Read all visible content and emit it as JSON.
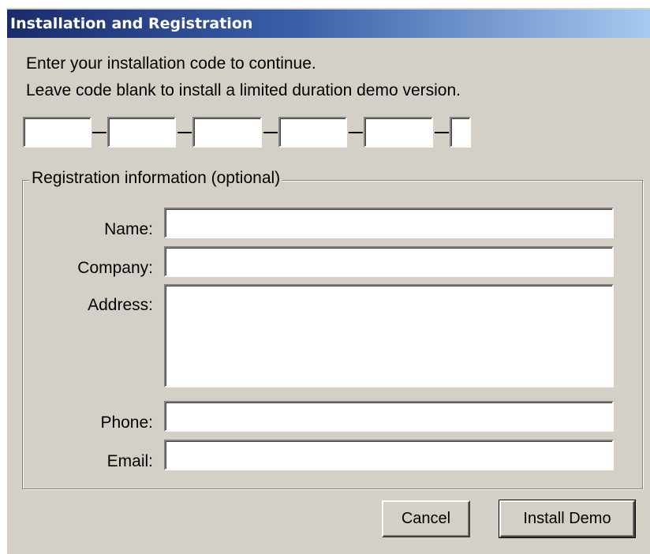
{
  "window": {
    "title": "Installation and Registration"
  },
  "instructions": {
    "line1": "Enter your installation code to continue.",
    "line2": "Leave code blank to install a limited duration demo version."
  },
  "install_code": {
    "segments": [
      "",
      "",
      "",
      "",
      "",
      ""
    ]
  },
  "registration": {
    "legend": "Registration information (optional)",
    "name_label": "Name:",
    "name_value": "",
    "company_label": "Company:",
    "company_value": "",
    "address_label": "Address:",
    "address_value": "",
    "phone_label": "Phone:",
    "phone_value": "",
    "email_label": "Email:",
    "email_value": ""
  },
  "buttons": {
    "cancel_label": "Cancel",
    "install_demo_label": "Install Demo"
  },
  "colors": {
    "dialog_bg": "#d4d0c8",
    "titlebar_start": "#1a2b6b",
    "titlebar_end": "#a6caf0",
    "title_text": "#ffffff"
  }
}
